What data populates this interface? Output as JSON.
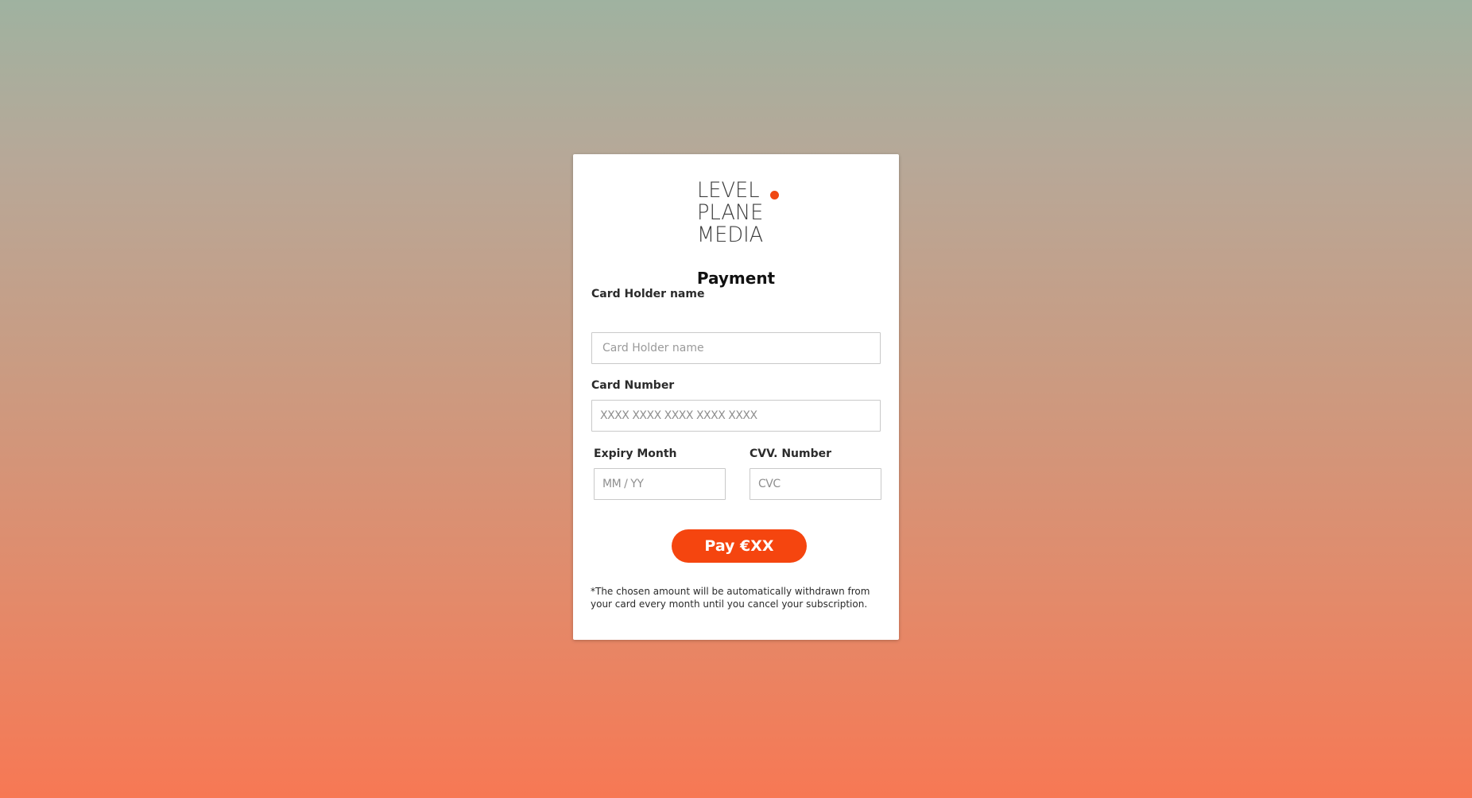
{
  "brand": {
    "logo_lines": [
      "LEVEL",
      "PLANE",
      "MEDIA"
    ],
    "accent_color": "#f04812"
  },
  "form": {
    "title": "Payment",
    "card_holder": {
      "label": "Card Holder name",
      "placeholder": "Card Holder name",
      "value": ""
    },
    "card_number": {
      "label": "Card Number",
      "placeholder": "XXXX XXXX XXXX XXXX XXXX",
      "value": ""
    },
    "expiry": {
      "label": "Expiry Month",
      "placeholder": "MM / YY",
      "value": ""
    },
    "cvv": {
      "label": "CVV. Number",
      "placeholder": "CVC",
      "value": ""
    },
    "pay_button_label": "Pay €XX",
    "pay_button_color": "#f5450f",
    "note": "*The chosen amount will be automatically withdrawn from your card every month until you cancel your subscription."
  }
}
